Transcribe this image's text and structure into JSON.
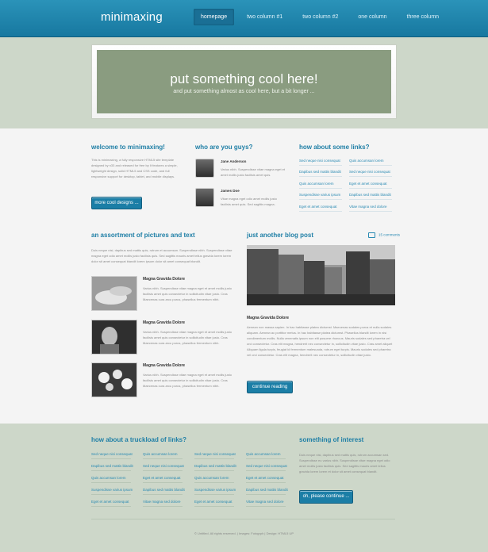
{
  "header": {
    "brand": "minimaxing",
    "menu": [
      "homepage",
      "two column #1",
      "two column #2",
      "one column",
      "three column"
    ]
  },
  "hero": {
    "title": "put something cool here!",
    "subtitle": "and put something almost as cool here, but a bit longer ..."
  },
  "welcome": {
    "heading": "welcome to minimaxing!",
    "text": "This is minimaxing, a fully responsive HTML5 site template designed by n33 and released for free by It features a simple, lightweight design, solid HTML5 and CSS code, and full responsive support for desktop, tablet, and mobile displays.",
    "button": "more cool designs ..."
  },
  "people": {
    "heading": "who are you guys?",
    "items": [
      {
        "name": "Jane Anderson",
        "text": "Varius nibh. Suspendisse vitae magna eget et amet mollis justo facilisis amet quis."
      },
      {
        "name": "James Doe",
        "text": "Vitae magna eget odio amet mollis justo facilisis amet quis. Sed sagittis magna."
      }
    ]
  },
  "links": {
    "heading": "how about some links?",
    "col1": [
      "Sed neque nisi consequat",
      "Dapibus sed mattis blandit",
      "Quis accumsan lorem",
      "Suspendisse varius ipsum",
      "Eget et amet consequat"
    ],
    "col2": [
      "Quis accumsan lorem",
      "Sed neque nisi consequat",
      "Eget et amet consequat",
      "Dapibus sed mattis blandit",
      "Vitae magna sed dolore"
    ]
  },
  "assortment": {
    "heading": "an assortment of pictures and text",
    "text": "Duis neque nisi, dapibus sed mattis quis, rutrum et accumsan. Suspendisse nibh. Suspendisse vitae magna eget odio amet mollis justo facilisis quis. Sed sagittis mauris amet tellus gravida lorem lorem dolor sit amet consequat blandit lorem ipsum dolor sit amet consequat blandit.",
    "items": [
      {
        "title": "Magna Gravida Dolore",
        "text": "Varius nibh. Suspendisse vitae magna eget et amet mollis justo facilisis amet quis consectetur in sollicitudin vitae justo. Cras Maecenas cura arcu purus, phasellus fermentum nibh."
      },
      {
        "title": "Magna Gravida Dolore",
        "text": "Varius nibh. Suspendisse vitae magna eget et amet mollis justo facilisis amet quis consectetur in sollicitudin vitae justo. Cras Maecenas cura arcu purus, phasellus fermentum nibh."
      },
      {
        "title": "Magna Gravida Dolore",
        "text": "Varius nibh. Suspendisse vitae magna eget et amet mollis justo facilisis amet quis consectetur in sollicitudin vitae justo. Cras Maecenas cura arcu purus, phasellus fermentum nibh."
      }
    ]
  },
  "blog": {
    "heading": "just another blog post",
    "comments": "15 comments",
    "title": "Magna Gravida Dolore",
    "text": "Aenean non massa sapien. In hac habitasse platea dictumst. Maecenas sodales purus et nulla sodales aliquam. Aenean ac porttitor metus. In hac habitasse platea dictumst. Phasellus blandit lorem in nisi condimentum mollis. Nulla venenatis ipsum non elit posuere rhoncus. Mauris sodales sed pharetra vel orci consectetur. Cras elit magna, hendrerit nec consectetur in, sollicitudin vitae justo. Cras amet aliquet Aliquam ligula turpis, feugiat id fermentum malesuada, rutrum eget turpis. Mauris sodales sed pharetra vel orci consectetur. Cras elit magna, hendrerit nec consectetur in, sollicitudin vitae justo.",
    "button": "continue reading"
  },
  "footer_links": {
    "heading": "how about a truckload of links?",
    "columns": [
      [
        "Sed neque nisi consequat",
        "Dapibus sed mattis blandit",
        "Quis accumsan lorem",
        "Suspendisse varius ipsum",
        "Eget et amet consequat"
      ],
      [
        "Quis accumsan lorem",
        "Sed neque nisi consequat",
        "Eget et amet consequat",
        "Dapibus sed mattis blandit",
        "Vitae magna sed dolore"
      ],
      [
        "Sed neque nisi consequat",
        "Dapibus sed mattis blandit",
        "Quis accumsan lorem",
        "Suspendisse varius ipsum",
        "Eget et amet consequat"
      ],
      [
        "Quis accumsan lorem",
        "Sed neque nisi consequat",
        "Eget et amet consequat",
        "Dapibus sed mattis blandit",
        "Vitae magna sed dolore"
      ]
    ]
  },
  "interest": {
    "heading": "something of interest",
    "text": "Duis neque nisi, dapibus sed mattis quis, rutrum accumsan sed. Suspendisse eu varius nibh. Suspendisse vitae magna eget odio amet mollis justo facilisis quis. Sed sagittis mauris amet tellus gravida lorem lorem et dolor sit amet consequat blandit.",
    "button": "oh, please continue ..."
  },
  "copyright": "© Untitled. All rights reserved. | Images: Fotogrph | Design: HTML5 UP"
}
